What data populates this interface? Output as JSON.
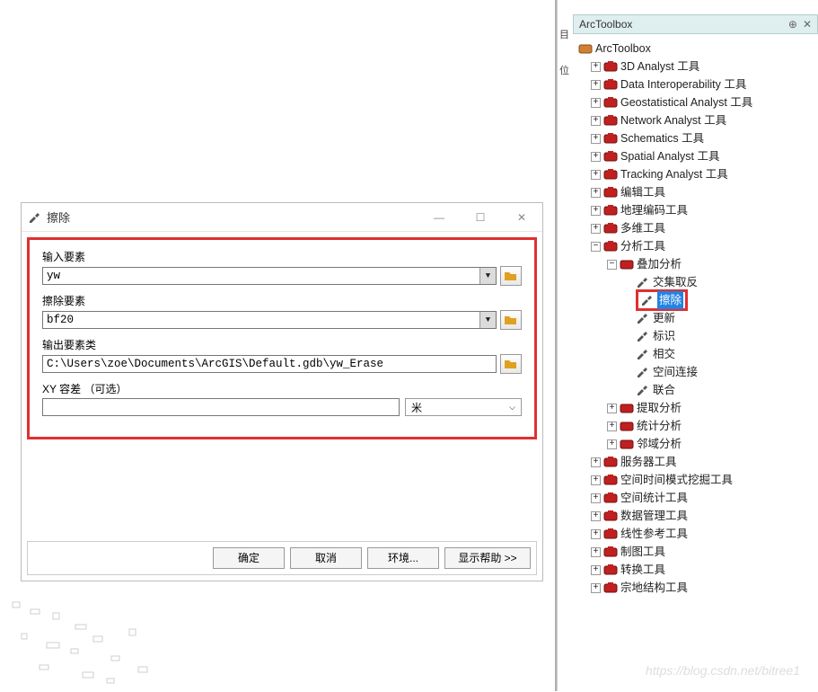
{
  "dialog": {
    "title": "擦除",
    "fields": {
      "input_label": "输入要素",
      "input_value": "yw",
      "erase_label": "擦除要素",
      "erase_value": "bf20",
      "output_label": "输出要素类",
      "output_value": "C:\\Users\\zoe\\Documents\\ArcGIS\\Default.gdb\\yw_Erase",
      "xy_label": "XY 容差 （可选）",
      "xy_value": "",
      "unit_value": "米"
    },
    "buttons": {
      "ok": "确定",
      "cancel": "取消",
      "env": "环境...",
      "help": "显示帮助 >>"
    }
  },
  "midbar": {
    "g1": "目",
    "g2": "位"
  },
  "panel": {
    "title": "ArcToolbox",
    "root": "ArcToolbox",
    "items": {
      "t0": "3D Analyst 工具",
      "t1": "Data Interoperability 工具",
      "t2": "Geostatistical Analyst 工具",
      "t3": "Network Analyst 工具",
      "t4": "Schematics 工具",
      "t5": "Spatial Analyst 工具",
      "t6": "Tracking Analyst 工具",
      "t7": "编辑工具",
      "t8": "地理编码工具",
      "t9": "多维工具",
      "t10": "分析工具",
      "s10_0": "叠加分析",
      "l0": "交集取反",
      "l1": "擦除",
      "l2": "更新",
      "l3": "标识",
      "l4": "相交",
      "l5": "空间连接",
      "l6": "联合",
      "s10_1": "提取分析",
      "s10_2": "统计分析",
      "s10_3": "邻域分析",
      "t11": "服务器工具",
      "t12": "空间时间模式挖掘工具",
      "t13": "空间统计工具",
      "t14": "数据管理工具",
      "t15": "线性参考工具",
      "t16": "制图工具",
      "t17": "转换工具",
      "t18": "宗地结构工具"
    }
  },
  "watermark": "https://blog.csdn.net/bitree1"
}
